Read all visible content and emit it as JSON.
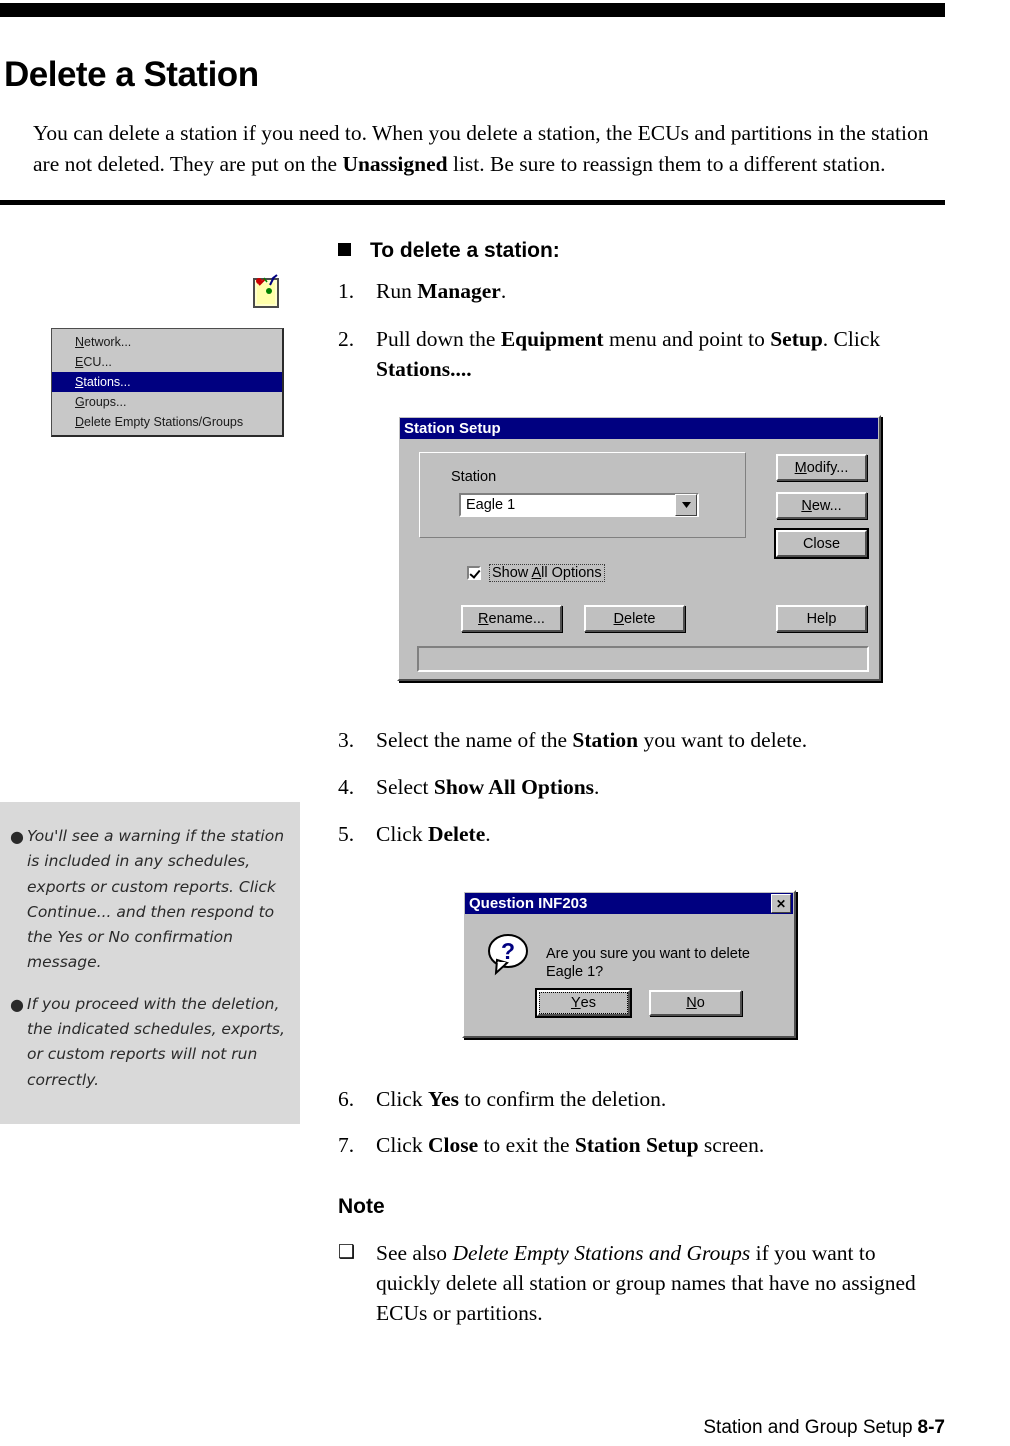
{
  "page": {
    "title": "Delete a Station",
    "intro_parts": {
      "a": "You can delete a station if you need to. When you delete a station, the ECUs and partitions in the station are not deleted. They are put on the ",
      "b": "Unassigned",
      "c": " list. Be sure to reassign them to a different station."
    }
  },
  "menu": {
    "items": [
      {
        "acc": "N",
        "rest": "etwork...",
        "selected": false
      },
      {
        "acc": "E",
        "rest": "CU...",
        "selected": false
      },
      {
        "acc": "S",
        "rest": "tations...",
        "selected": true
      },
      {
        "acc": "G",
        "rest": "roups...",
        "selected": false
      },
      {
        "acc": "D",
        "rest": "elete Empty Stations/Groups",
        "selected": false
      }
    ]
  },
  "procedure": {
    "heading": "To delete a station:",
    "steps": [
      {
        "num": "1.",
        "a": "Run ",
        "b": "Manager",
        "c": ".",
        "d": "",
        "e": "",
        "f": ""
      },
      {
        "num": "2.",
        "a": "Pull down the ",
        "b": "Equipment",
        "c": " menu and point to ",
        "d": "Setup",
        "e": ". Click ",
        "f": "Stations...."
      },
      {
        "num": "3.",
        "a": "Select the name of the ",
        "b": "Station",
        "c": " you want to delete.",
        "d": "",
        "e": "",
        "f": ""
      },
      {
        "num": "4.",
        "a": "Select ",
        "b": "Show All Options",
        "c": ".",
        "d": "",
        "e": "",
        "f": ""
      },
      {
        "num": "5.",
        "a": "Click ",
        "b": "Delete",
        "c": ".",
        "d": "",
        "e": "",
        "f": ""
      },
      {
        "num": "6.",
        "a": "Click ",
        "b": "Yes",
        "c": " to confirm the deletion.",
        "d": "",
        "e": "",
        "f": ""
      },
      {
        "num": "7.",
        "a": "Click ",
        "b": "Close",
        "c": " to exit the ",
        "d": "Station Setup",
        "e": " screen.",
        "f": ""
      }
    ]
  },
  "station_setup_dialog": {
    "title": "Station Setup",
    "station_label": "Station",
    "station_value": "Eagle 1",
    "show_all_options": {
      "checked": true,
      "acc_before": "Show ",
      "acc": "A",
      "acc_after": "ll Options"
    },
    "buttons": {
      "modify": {
        "acc_before": "",
        "acc": "M",
        "acc_after": "odify..."
      },
      "new": {
        "acc_before": "",
        "acc": "N",
        "acc_after": "ew..."
      },
      "close": {
        "acc_before": "",
        "acc": "",
        "acc_after": "Close"
      },
      "help": {
        "acc_before": "",
        "acc": "",
        "acc_after": "Help"
      },
      "rename": {
        "acc_before": "",
        "acc": "R",
        "acc_after": "ename..."
      },
      "delete": {
        "acc_before": "",
        "acc": "D",
        "acc_after": "elete"
      }
    },
    "statusbar_text": ""
  },
  "question_dialog": {
    "title": "Question INF203",
    "close_glyph": "✕",
    "message": "Are you sure you want to delete Eagle 1?",
    "buttons": {
      "yes": {
        "acc": "Y",
        "rest": "es"
      },
      "no": {
        "acc": "N",
        "rest": "o"
      }
    }
  },
  "sidebar_note": {
    "bullets": [
      "You'll see a warning if the station is included in any schedules, exports or custom reports. Click Continue... and then respond to the Yes or No confirmation message.",
      "If you proceed with the deletion, the indicated schedules, exports, or custom reports will not run correctly."
    ],
    "bullet_mark": "●"
  },
  "note_section": {
    "heading": "Note",
    "mark": "❑",
    "item": {
      "a": "See also ",
      "b": "Delete Empty Stations and Groups",
      "c": " if you want to quickly delete all station or group names that have no assigned ECUs or partitions."
    }
  },
  "footer": {
    "section": "Station and Group Setup",
    "page_number": "8-7"
  },
  "colors": {
    "title_bar": "#000080",
    "dialog_face": "#c0c0c0",
    "menu_face": "#c8c8c8",
    "sidebar_bg": "#d9d9d9"
  }
}
